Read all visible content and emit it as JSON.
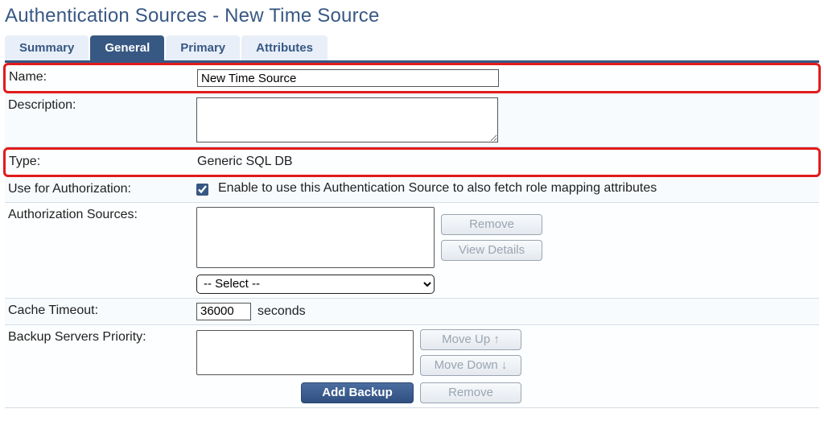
{
  "page_title": "Authentication Sources - New Time Source",
  "tabs": {
    "summary": "Summary",
    "general": "General",
    "primary": "Primary",
    "attributes": "Attributes"
  },
  "name": {
    "label": "Name:",
    "value": "New Time Source"
  },
  "description": {
    "label": "Description:",
    "value": ""
  },
  "type": {
    "label": "Type:",
    "value": "Generic SQL DB"
  },
  "use_for_auth": {
    "label": "Use for Authorization:",
    "checked": true,
    "text": "Enable to use this Authentication Source to also fetch role mapping attributes"
  },
  "auth_sources": {
    "label": "Authorization Sources:",
    "select_placeholder": "-- Select --",
    "remove_btn": "Remove",
    "view_btn": "View Details"
  },
  "cache_timeout": {
    "label": "Cache Timeout:",
    "value": "36000",
    "units": "seconds"
  },
  "backup": {
    "label": "Backup Servers Priority:",
    "move_up": "Move Up ↑",
    "move_down": "Move Down ↓",
    "add": "Add Backup",
    "remove": "Remove"
  }
}
